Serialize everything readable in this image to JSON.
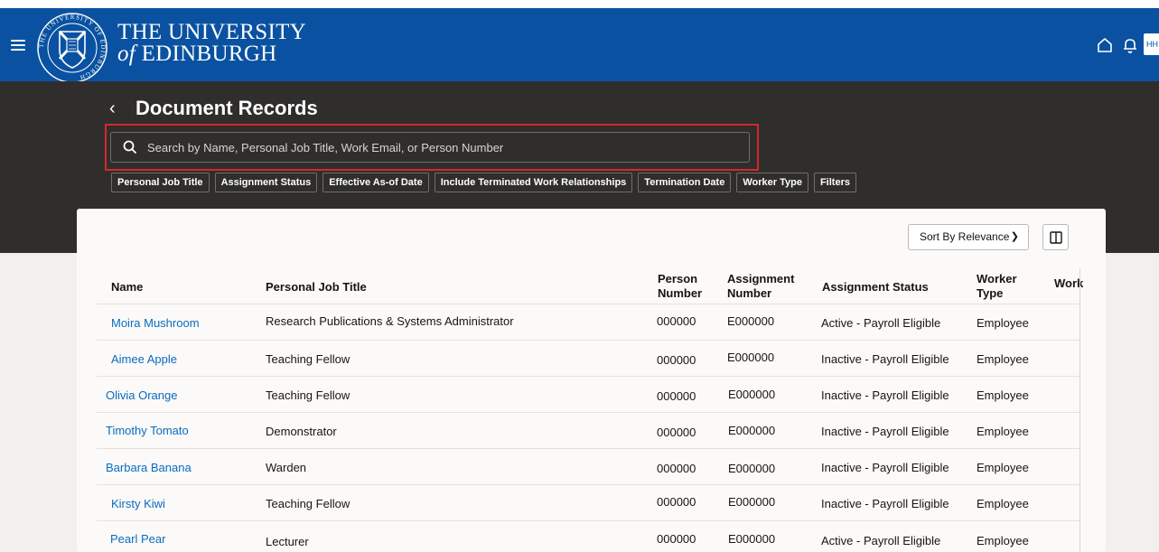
{
  "header": {
    "university_line1": "THE UNIVERSITY",
    "university_line2_prefix": "of",
    "university_line2": "EDINBURGH",
    "avatar_initials": "HH",
    "crest_text": "THE UNIVERSITY OF EDINBURGH",
    "brand_color": "#0a52a1"
  },
  "page": {
    "back_icon": "chevron-left-icon",
    "title": "Document Records"
  },
  "search": {
    "placeholder": "Search by Name, Personal Job Title, Work Email, or Person Number",
    "value": "",
    "highlight_color": "#d8262e"
  },
  "filters": [
    "Personal Job Title",
    "Assignment Status",
    "Effective As-of Date",
    "Include Terminated Work Relationships",
    "Termination Date",
    "Worker Type",
    "Filters"
  ],
  "toolbar": {
    "sort_label": "Sort By Relevance"
  },
  "table": {
    "columns": {
      "name": "Name",
      "job_title": "Personal Job Title",
      "person_number_1": "Person",
      "person_number_2": "Number",
      "assignment_number_1": "Assignment",
      "assignment_number_2": "Number",
      "assignment_status": "Assignment Status",
      "worker_type_1": "Worker",
      "worker_type_2": "Type",
      "work": "Work"
    },
    "rows": [
      {
        "name": "Moira Mushroom",
        "job_title": "Research Publications & Systems Administrator",
        "person_number": "000000",
        "assignment_number": "E000000",
        "assignment_status": "Active - Payroll Eligible",
        "worker_type": "Employee"
      },
      {
        "name": "Aimee Apple",
        "job_title": "Teaching Fellow",
        "person_number": "000000",
        "assignment_number": "E000000",
        "assignment_status": "Inactive - Payroll Eligible",
        "worker_type": "Employee"
      },
      {
        "name": "Olivia Orange",
        "job_title": "Teaching Fellow",
        "person_number": "000000",
        "assignment_number": "E000000",
        "assignment_status": "Inactive - Payroll Eligible",
        "worker_type": "Employee"
      },
      {
        "name": "Timothy Tomato",
        "job_title": "Demonstrator",
        "person_number": "000000",
        "assignment_number": "E000000",
        "assignment_status": "Inactive - Payroll Eligible",
        "worker_type": "Employee"
      },
      {
        "name": "Barbara Banana",
        "job_title": "Warden",
        "person_number": "000000",
        "assignment_number": "E000000",
        "assignment_status": "Inactive - Payroll Eligible",
        "worker_type": "Employee"
      },
      {
        "name": "Kirsty Kiwi",
        "job_title": "Teaching Fellow",
        "person_number": "000000",
        "assignment_number": "E000000",
        "assignment_status": "Inactive - Payroll Eligible",
        "worker_type": "Employee"
      },
      {
        "name": "Pearl Pear",
        "job_title": "Lecturer",
        "person_number": "000000",
        "assignment_number": "E000000",
        "assignment_status": "Active - Payroll Eligible",
        "worker_type": "Employee"
      }
    ]
  }
}
